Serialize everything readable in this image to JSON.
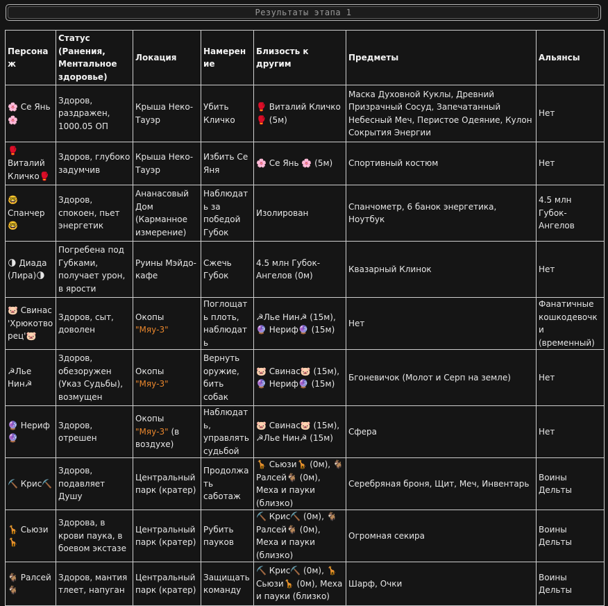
{
  "header": {
    "title": "Результаты этапа 1"
  },
  "table": {
    "headers": {
      "character": "Персонаж",
      "status": "Статус (Ранения, Ментальное здоровье)",
      "location": "Локация",
      "intent": "Намерение",
      "proximity": "Близость к другим",
      "items": "Предметы",
      "alliances": "Альянсы"
    },
    "rows": [
      {
        "character": "🌸 Се Янь 🌸",
        "status": "Здоров, раздражен, 1000.05 ОП",
        "location": "Крыша Неко-Тауэр",
        "location_hl": "",
        "location_suffix": "",
        "intent": "Убить Кличко",
        "proximity": "🥊 Виталий Кличко 🥊 (5м)",
        "items": "Маска Духовной Куклы, Древний Призрачный Сосуд, Запечатанный Небесный Меч, Перистое Одеяние, Кулон Сокрытия Энергии",
        "alliances": "Нет"
      },
      {
        "character": "🥊 Виталий Кличко🥊",
        "status": "Здоров, глубоко задумчив",
        "location": "Крыша Неко-Тауэр",
        "location_hl": "",
        "location_suffix": "",
        "intent": "Избить Се Яня",
        "proximity": "🌸 Се Янь 🌸 (5м)",
        "items": "Спортивный костюм",
        "alliances": "Нет"
      },
      {
        "character": "🤓 Спанчер 🤓",
        "status": "Здоров, спокоен, пьет энергетик",
        "location": "Ананасовый Дом (Карманное измерение)",
        "location_hl": "",
        "location_suffix": "",
        "intent": "Наблюдать за победой Губок",
        "proximity": "Изолирован",
        "items": "Спанчометр, 6 банок энергетика, Ноутбук",
        "alliances": "4.5 млн Губок-Ангелов"
      },
      {
        "character": "🌗 Диада (Лира)🌗",
        "status": "Погребена под Губками, получает урон, в ярости",
        "location": "Руины Мэйдо-кафе",
        "location_hl": "",
        "location_suffix": "",
        "intent": "Сжечь Губок",
        "proximity": "4.5 млн Губок-Ангелов (0м)",
        "items": "Квазарный Клинок",
        "alliances": "Нет"
      },
      {
        "character": "🐷 Свинас 'Хрюкотворец'🐷",
        "status": "Здоров, сыт, доволен",
        "location": "Окопы ",
        "location_hl": "\"Мяу-3\"",
        "location_suffix": "",
        "intent": "Поглощать плоть, наблюдать",
        "proximity": "☭Лье Нин☭ (15м), 🔮 Нериф🔮 (15м)",
        "items": "Нет",
        "alliances": "Фанатичные кошкодевочки (временный)"
      },
      {
        "character": "☭Лье Нин☭",
        "status": "Здоров, обезоружен (Указ Судьбы), возмущен",
        "location": "Окопы ",
        "location_hl": "\"Мяу-3\"",
        "location_suffix": "",
        "intent": "Вернуть оружие, бить собак",
        "proximity": "🐷 Свинас🐷 (15м), 🔮 Нериф🔮 (15м)",
        "items": "Бгоневичок (Молот и Серп на земле)",
        "alliances": "Нет"
      },
      {
        "character": "🔮 Нериф 🔮",
        "status": "Здоров, отрешен",
        "location": "Окопы ",
        "location_hl": "\"Мяу-3\"",
        "location_suffix": " (в воздухе)",
        "intent": "Наблюдать, управлять судьбой",
        "proximity": "🐷 Свинас🐷 (15м), ☭Лье Нин☭ (15м)",
        "items": "Сфера",
        "alliances": "Нет"
      },
      {
        "character": "⛏️ Крис⛏️",
        "status": "Здоров, подавляет Душу",
        "location": "Центральный парк (кратер)",
        "location_hl": "",
        "location_suffix": "",
        "intent": "Продолжать саботаж",
        "proximity": "🦒 Сьюзи🦒 (0м), 🐐 Ралсей🐐 (0м), Меха и пауки (близко)",
        "items": "Серебряная броня, Щит, Меч, Инвентарь",
        "alliances": "Воины Дельты"
      },
      {
        "character": "🦒 Сьюзи 🦒",
        "status": "Здорова, в крови паука, в боевом экстазе",
        "location": "Центральный парк (кратер)",
        "location_hl": "",
        "location_suffix": "",
        "intent": "Рубить пауков",
        "proximity": "⛏️ Крис⛏️ (0м), 🐐 Ралсей🐐 (0м), Меха и пауки (близко)",
        "items": "Огромная секира",
        "alliances": "Воины Дельты"
      },
      {
        "character": "🐐 Ралсей 🐐",
        "status": "Здоров, мантия тлеет, напуган",
        "location": "Центральный парк (кратер)",
        "location_hl": "",
        "location_suffix": "",
        "intent": "Защищать команду",
        "proximity": "⛏️ Крис⛏️ (0м), 🦒 Сьюзи🦒 (0м), Меха и пауки (близко)",
        "items": "Шарф, Очки",
        "alliances": "Воины Дельты"
      }
    ]
  }
}
